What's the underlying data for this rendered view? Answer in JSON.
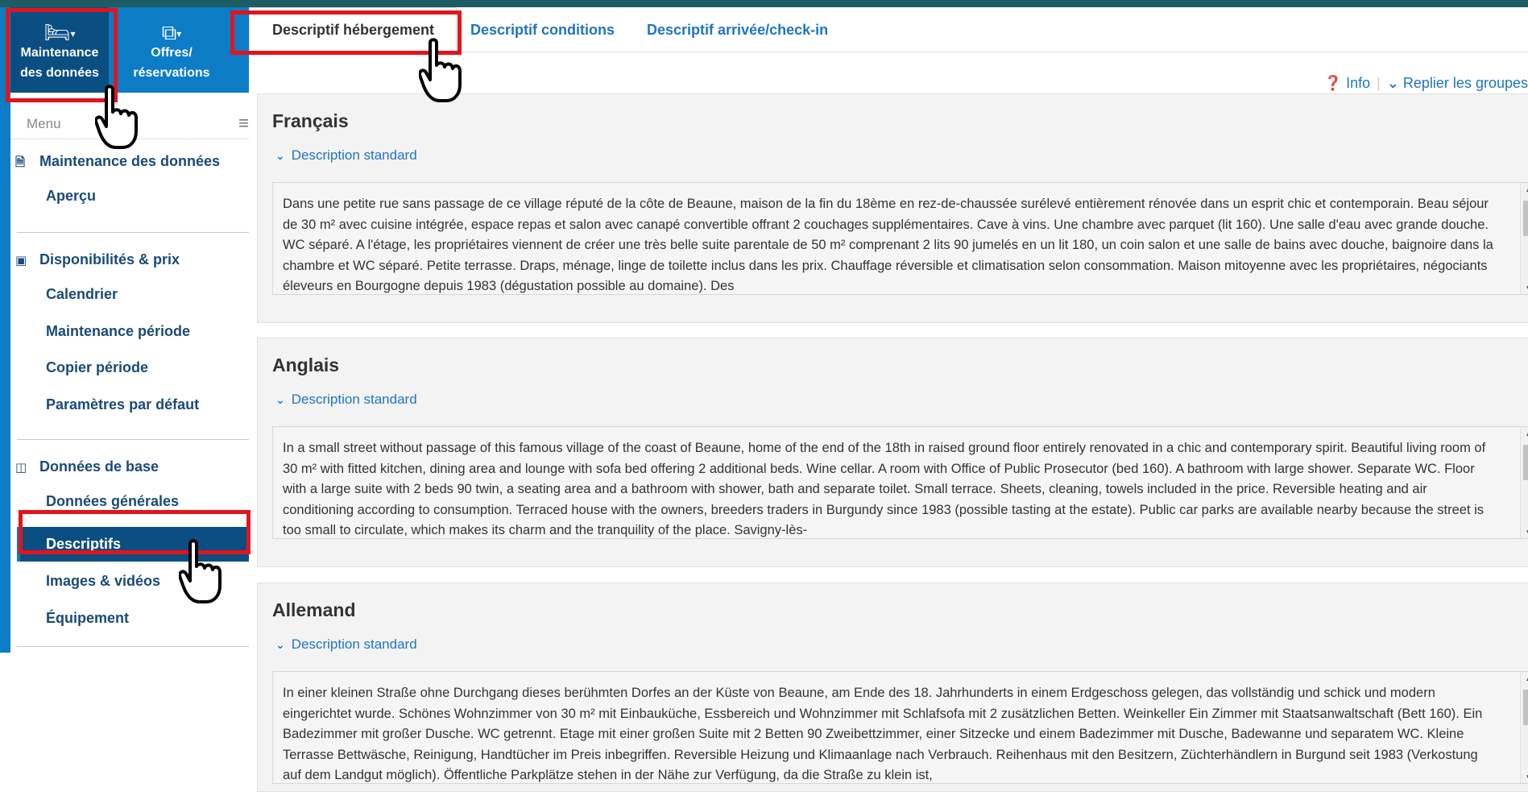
{
  "modules": [
    {
      "label_line1": "Maintenance",
      "label_line2": "des données",
      "icon": "bed-icon"
    },
    {
      "label_line1": "Offres/",
      "label_line2": "réservations",
      "icon": "copy-icon"
    }
  ],
  "menu": {
    "label": "Menu",
    "icon": "hamburger-icon"
  },
  "sections": [
    {
      "title": "Maintenance des données",
      "icon": "document-icon",
      "items": [
        "Aperçu"
      ]
    },
    {
      "title": "Disponibilités & prix",
      "icon": "money-icon",
      "items": [
        "Calendrier",
        "Maintenance période",
        "Copier période",
        "Paramètres par défaut"
      ]
    },
    {
      "title": "Données de base",
      "icon": "columns-icon",
      "items": [
        "Données générales",
        "Descriptifs",
        "Images & vidéos",
        "Équipement"
      ]
    }
  ],
  "tabs": [
    "Descriptif hébergement",
    "Descriptif conditions",
    "Descriptif arrivée/check-in"
  ],
  "toolbar": {
    "info": "Info",
    "collapse": "Replier les groupes"
  },
  "panels": [
    {
      "language": "Français",
      "subheading": "Description standard",
      "text": "Dans une petite rue sans passage de ce village réputé de la côte de Beaune, maison de la fin du 18ème en rez-de-chaussée surélevé entièrement rénovée dans un esprit chic et contemporain. Beau séjour de 30 m² avec cuisine intégrée, espace repas et salon avec canapé convertible offrant 2 couchages supplémentaires. Cave à vins. Une chambre avec parquet (lit 160). Une salle d'eau avec grande douche. WC séparé. A l'étage, les propriétaires viennent de créer une très belle suite parentale de 50 m² comprenant 2 lits 90 jumelés en un lit 180, un coin salon et une salle de bains avec douche, baignoire dans la chambre et WC séparé. Petite terrasse. Draps, ménage, linge de toilette inclus dans les prix. Chauffage réversible et climatisation selon consommation. Maison mitoyenne avec les propriétaires, négociants éleveurs en Bourgogne depuis 1983 (dégustation possible au domaine). Des"
    },
    {
      "language": "Anglais",
      "subheading": "Description standard",
      "text": "In a small street without passage of this famous village of the coast of Beaune, home of the end of the 18th in raised ground floor entirely renovated in a chic and contemporary spirit. Beautiful living room of 30 m² with fitted kitchen, dining area and lounge with sofa bed offering 2 additional beds. Wine cellar. A room with Office of Public Prosecutor (bed 160). A bathroom with large shower. Separate WC. Floor with a large suite with 2 beds 90 twin, a seating area and a bathroom with shower, bath and separate toilet. Small terrace. Sheets, cleaning, towels included in the price. Reversible heating and air conditioning according to consumption. Terraced house with the owners, breeders traders in Burgundy since 1983 (possible tasting at the estate). Public car parks are available nearby because the street is too small to circulate, which makes its charm and the tranquility of the place. Savigny-lès-"
    },
    {
      "language": "Allemand",
      "subheading": "Description standard",
      "text": "In einer kleinen Straße ohne Durchgang dieses berühmten Dorfes an der Küste von Beaune, am Ende des 18. Jahrhunderts in einem Erdgeschoss gelegen, das vollständig und schick und modern eingerichtet wurde. Schönes Wohnzimmer von 30 m² mit Einbauküche, Essbereich und Wohnzimmer mit Schlafsofa mit 2 zusätzlichen Betten. Weinkeller Ein Zimmer mit Staatsanwaltschaft (Bett 160). Ein Badezimmer mit großer Dusche. WC getrennt. Etage mit einer großen Suite mit 2 Betten 90 Zweibettzimmer, einer Sitzecke und einem Badezimmer mit Dusche, Badewanne und separatem WC. Kleine Terrasse Bettwäsche, Reinigung, Handtücher im Preis inbegriffen. Reversible Heizung und Klimaanlage nach Verbrauch. Reihenhaus mit den Besitzern, Züchterhändlern in Burgund seit 1983 (Verkostung auf dem Landgut möglich). Öffentliche Parkplätze stehen in der Nähe zur Verfügung, da die Straße zu klein ist,"
    }
  ],
  "colors": {
    "highlight": "#e3141c",
    "module_bg": "#0c7cc6",
    "module_active": "#0b4e82",
    "link": "#1f74c4"
  }
}
